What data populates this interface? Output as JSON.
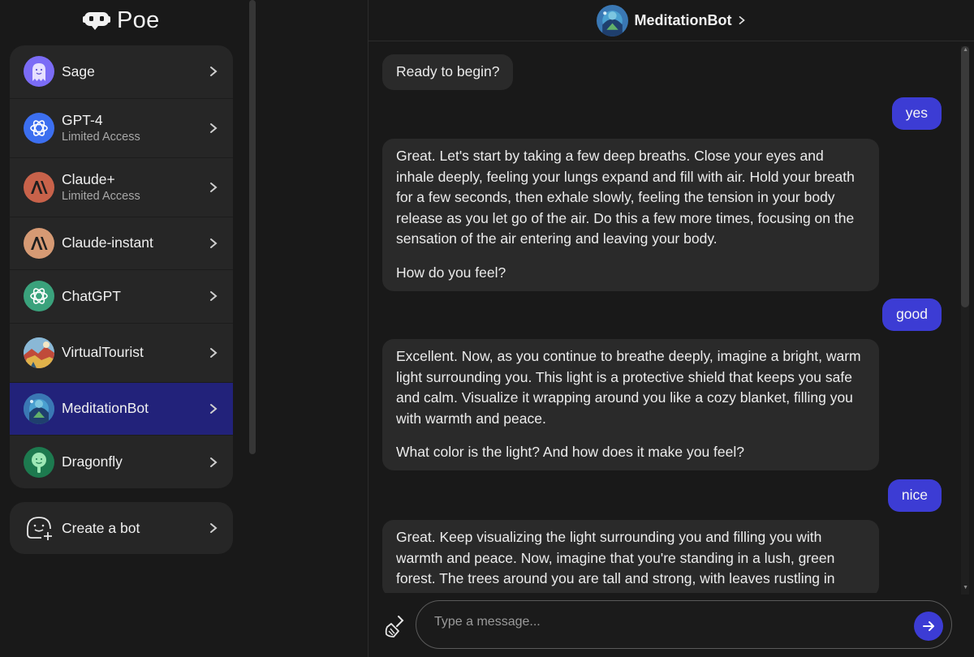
{
  "app": {
    "name": "Poe"
  },
  "sidebar": {
    "bots": [
      {
        "name": "Sage",
        "sub": "",
        "icon": "sage-avatar-icon"
      },
      {
        "name": "GPT-4",
        "sub": "Limited Access",
        "icon": "openai-logo-icon"
      },
      {
        "name": "Claude+",
        "sub": "Limited Access",
        "icon": "anthropic-logo-icon"
      },
      {
        "name": "Claude-instant",
        "sub": "",
        "icon": "anthropic-logo-icon"
      },
      {
        "name": "ChatGPT",
        "sub": "",
        "icon": "openai-logo-icon"
      },
      {
        "name": "VirtualTourist",
        "sub": "",
        "icon": "virtualtourist-avatar-icon"
      },
      {
        "name": "MeditationBot",
        "sub": "",
        "icon": "meditationbot-avatar-icon",
        "active": true
      },
      {
        "name": "Dragonfly",
        "sub": "",
        "icon": "dragonfly-avatar-icon"
      }
    ],
    "create_bot_label": "Create a bot"
  },
  "chat": {
    "title": "MeditationBot",
    "messages": [
      {
        "role": "bot",
        "paragraphs": [
          "Ready to begin?"
        ]
      },
      {
        "role": "user",
        "text": "yes"
      },
      {
        "role": "bot",
        "paragraphs": [
          "Great. Let's start by taking a few deep breaths. Close your eyes and inhale deeply, feeling your lungs expand and fill with air. Hold your breath for a few seconds, then exhale slowly, feeling the tension in your body release as you let go of the air. Do this a few more times, focusing on the sensation of the air entering and leaving your body.",
          "How do you feel?"
        ]
      },
      {
        "role": "user",
        "text": "good"
      },
      {
        "role": "bot",
        "paragraphs": [
          "Excellent. Now, as you continue to breathe deeply, imagine a bright, warm light surrounding you. This light is a protective shield that keeps you safe and calm. Visualize it wrapping around you like a cozy blanket, filling you with warmth and peace.",
          "What color is the light? And how does it make you feel?"
        ]
      },
      {
        "role": "user",
        "text": "nice"
      },
      {
        "role": "bot",
        "paragraphs": [
          "Great. Keep visualizing the light surrounding you and filling you with warmth and peace. Now, imagine that you're standing in a lush, green forest. The trees around you are tall and strong, with leaves rustling in"
        ]
      }
    ]
  },
  "composer": {
    "placeholder": "Type a message..."
  },
  "colors": {
    "accent": "#3c3cd4",
    "active_item": "#22227a",
    "background": "#191919",
    "panel": "#262626",
    "bot_bubble": "#2a2a2a"
  }
}
